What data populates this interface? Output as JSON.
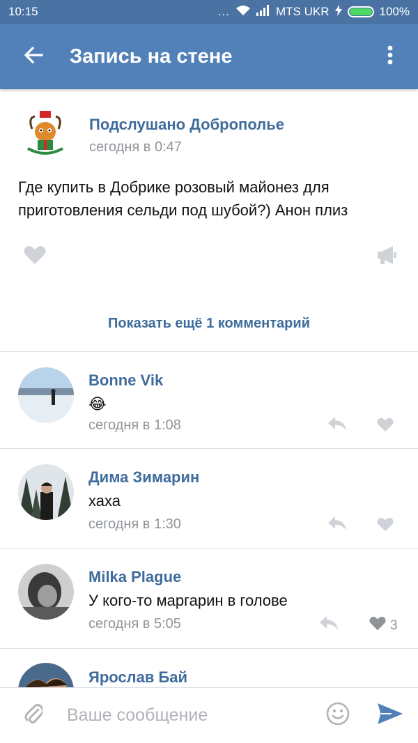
{
  "status_bar": {
    "time": "10:15",
    "dots": "...",
    "carrier": "MTS UKR",
    "battery": "100%"
  },
  "app_bar": {
    "title": "Запись на стене",
    "back_icon": "arrow-left-icon",
    "more_icon": "more-vertical-icon"
  },
  "post": {
    "author": "Подслушано Доброполье",
    "time": "сегодня в 0:47",
    "text": "Где купить в Добрике  розовый майонез для приготовления сельди под шубой?) Анон плиз",
    "avatar_text": "ПОДСЛУШАНО"
  },
  "show_more": "Показать ещё 1 комментарий",
  "comments": [
    {
      "name": "Bonne Vik",
      "text": "😂",
      "time": "сегодня в 1:08",
      "likes": ""
    },
    {
      "name": "Дима Зимарин",
      "text": "хаха",
      "time": "сегодня в 1:30",
      "likes": ""
    },
    {
      "name": "Milka Plague",
      "text": "У кого-то маргарин в голове",
      "time": "сегодня в 5:05",
      "likes": "3"
    },
    {
      "name": "Ярослав Бай"
    }
  ],
  "input": {
    "placeholder": "Ваше сообщение"
  },
  "colors": {
    "status_bar": "#4a72a3",
    "app_bar": "#5181b8",
    "link": "#3f6c9c",
    "meta": "#909499",
    "icon_gray": "#cfd3d8",
    "send": "#5181b8"
  }
}
